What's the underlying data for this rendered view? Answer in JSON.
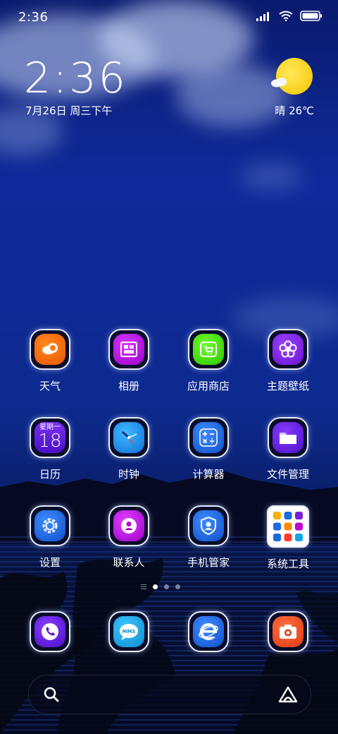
{
  "status_bar": {
    "time": "2:36"
  },
  "clock_widget": {
    "time": "2:36",
    "date": "7月26日 周三下午"
  },
  "weather_widget": {
    "condition_temp": "晴 26℃"
  },
  "apps": [
    {
      "label": "天气",
      "icon": "weather-icon",
      "color": "#ff6a00"
    },
    {
      "label": "相册",
      "icon": "gallery-icon",
      "color": "#b100d6"
    },
    {
      "label": "应用商店",
      "icon": "app-store-icon",
      "color": "#3fd600"
    },
    {
      "label": "主题壁纸",
      "icon": "themes-icon",
      "color": "#7a1fd8"
    },
    {
      "label": "日历",
      "icon": "calendar-icon",
      "color": "#5a18d0",
      "calendar_weekday": "星期一",
      "calendar_day": "18"
    },
    {
      "label": "时钟",
      "icon": "clock-icon",
      "color": "#1d8fe6"
    },
    {
      "label": "计算器",
      "icon": "calculator-icon",
      "color": "#1b6ae0"
    },
    {
      "label": "文件管理",
      "icon": "file-manager-icon",
      "color": "#5a14d8"
    },
    {
      "label": "设置",
      "icon": "settings-icon",
      "color": "#1b6fe6"
    },
    {
      "label": "联系人",
      "icon": "contacts-icon",
      "color": "#c000d0"
    },
    {
      "label": "手机管家",
      "icon": "security-icon",
      "color": "#1b6ae0"
    },
    {
      "label": "系统工具",
      "icon": "system-tools-folder-icon",
      "color": "#ffffff"
    }
  ],
  "dock": [
    {
      "icon": "phone-icon",
      "color": "#5a14d8"
    },
    {
      "icon": "messages-icon",
      "color": "#10a8e6",
      "badge_text": "MMS"
    },
    {
      "icon": "browser-icon",
      "color": "#1b6ae0"
    },
    {
      "icon": "camera-icon",
      "color": "#ff4a14"
    }
  ],
  "page_indicator": {
    "pages": 3,
    "active": 1
  }
}
